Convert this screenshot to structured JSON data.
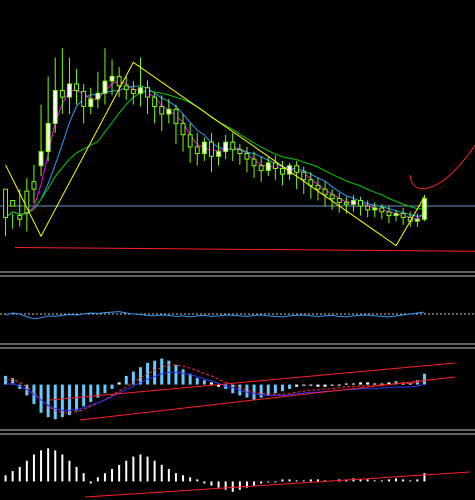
{
  "colors": {
    "background": "#000000",
    "bull_candle": "#7CFC00",
    "bull_body": "#FFFFFF",
    "bear_candle": "#7CFC00",
    "bear_body": "#000000",
    "zigzag": "#FFFF00",
    "ma_fast": "#FF00FF",
    "ma_mid": "#3399FF",
    "ma_slow": "#00CC00",
    "trend_red": "#FF2020",
    "hline": "#6699CC",
    "separator": "#C0C0C0",
    "rsi_line": "#3399FF",
    "rsi_level": "#C0C0C0",
    "hist_pos": "#66CCFF",
    "hist_neg": "#66CCFF",
    "hist_white": "#FFFFFF",
    "signal_red": "#FF3030",
    "signal_blue": "#3333FF"
  },
  "chart_data": [
    {
      "type": "candlestick",
      "panel": "price",
      "title": "",
      "candles": [
        [
          70,
          40,
          20,
          60
        ],
        [
          58,
          52,
          28,
          44
        ],
        [
          42,
          38,
          30,
          70
        ],
        [
          68,
          45,
          25,
          82
        ],
        [
          78,
          70,
          55,
          96
        ],
        [
          95,
          110,
          84,
          160
        ],
        [
          110,
          140,
          100,
          190
        ],
        [
          140,
          175,
          130,
          210
        ],
        [
          175,
          168,
          150,
          220
        ],
        [
          168,
          182,
          150,
          210
        ],
        [
          182,
          175,
          160,
          198
        ],
        [
          174,
          158,
          140,
          182
        ],
        [
          158,
          166,
          150,
          178
        ],
        [
          166,
          172,
          156,
          195
        ],
        [
          172,
          185,
          160,
          220
        ],
        [
          185,
          190,
          170,
          208
        ],
        [
          190,
          180,
          168,
          200
        ],
        [
          180,
          176,
          165,
          190
        ],
        [
          176,
          172,
          160,
          185
        ],
        [
          172,
          178,
          158,
          210
        ],
        [
          178,
          168,
          150,
          186
        ],
        [
          168,
          158,
          140,
          172
        ],
        [
          158,
          150,
          132,
          170
        ],
        [
          150,
          155,
          140,
          166
        ],
        [
          155,
          140,
          118,
          160
        ],
        [
          140,
          128,
          110,
          150
        ],
        [
          128,
          115,
          98,
          140
        ],
        [
          115,
          108,
          95,
          130
        ],
        [
          108,
          120,
          100,
          125
        ],
        [
          120,
          105,
          88,
          130
        ],
        [
          105,
          110,
          95,
          120
        ],
        [
          110,
          120,
          102,
          128
        ],
        [
          120,
          112,
          100,
          130
        ],
        [
          112,
          108,
          96,
          118
        ],
        [
          108,
          102,
          88,
          115
        ],
        [
          102,
          95,
          82,
          110
        ],
        [
          95,
          90,
          78,
          105
        ],
        [
          90,
          98,
          84,
          104
        ],
        [
          98,
          92,
          80,
          106
        ],
        [
          92,
          86,
          74,
          100
        ],
        [
          86,
          95,
          80,
          98
        ],
        [
          95,
          88,
          70,
          100
        ],
        [
          88,
          80,
          65,
          94
        ],
        [
          80,
          74,
          60,
          88
        ],
        [
          74,
          70,
          58,
          82
        ],
        [
          70,
          64,
          52,
          78
        ],
        [
          64,
          60,
          48,
          70
        ],
        [
          60,
          56,
          45,
          66
        ],
        [
          56,
          54,
          44,
          62
        ],
        [
          54,
          58,
          46,
          64
        ],
        [
          58,
          52,
          42,
          62
        ],
        [
          52,
          48,
          40,
          58
        ],
        [
          48,
          50,
          40,
          56
        ],
        [
          50,
          46,
          38,
          54
        ],
        [
          46,
          42,
          34,
          52
        ],
        [
          42,
          44,
          36,
          48
        ],
        [
          44,
          40,
          32,
          50
        ],
        [
          40,
          36,
          30,
          46
        ],
        [
          36,
          38,
          30,
          44
        ],
        [
          38,
          60,
          36,
          64
        ]
      ],
      "ylim": [
        0,
        250
      ]
    },
    {
      "type": "line",
      "panel": "oscillator",
      "title": "",
      "values": [
        48,
        52,
        50,
        44,
        40,
        42,
        46,
        45,
        47,
        49,
        48,
        50,
        52,
        51,
        53,
        54,
        55,
        52,
        50,
        49,
        47,
        46,
        48,
        47,
        45,
        46,
        44,
        46,
        47,
        45,
        46,
        48,
        47,
        46,
        45,
        47,
        48,
        46,
        45,
        44,
        46,
        47,
        48,
        46,
        45,
        46,
        47,
        45,
        44,
        46,
        47,
        48,
        46,
        45,
        44,
        46,
        48,
        50,
        52,
        54
      ],
      "level": 50,
      "ylim": [
        0,
        100
      ]
    },
    {
      "type": "bar",
      "panel": "macd",
      "title": "",
      "values": [
        8,
        6,
        -4,
        -10,
        -18,
        -26,
        -30,
        -32,
        -30,
        -28,
        -24,
        -20,
        -16,
        -12,
        -8,
        -4,
        2,
        8,
        12,
        16,
        20,
        22,
        24,
        22,
        18,
        14,
        10,
        6,
        4,
        2,
        -2,
        -4,
        -8,
        -10,
        -12,
        -14,
        -12,
        -10,
        -8,
        -6,
        -4,
        -2,
        -1,
        -1,
        -2,
        -2,
        -1,
        -1,
        1,
        1,
        2,
        2,
        1,
        1,
        2,
        3,
        2,
        1,
        4,
        10
      ],
      "signal": [
        4,
        5,
        2,
        -2,
        -8,
        -14,
        -20,
        -24,
        -26,
        -26,
        -25,
        -23,
        -20,
        -17,
        -14,
        -10,
        -6,
        -2,
        2,
        6,
        10,
        13,
        16,
        18,
        18,
        17,
        15,
        13,
        10,
        8,
        5,
        2,
        0,
        -3,
        -5,
        -7,
        -8,
        -9,
        -9,
        -9,
        -8,
        -7,
        -6,
        -5,
        -5,
        -4,
        -4,
        -3,
        -2,
        -2,
        -1,
        -1,
        -1,
        0,
        0,
        1,
        1,
        1,
        2,
        4
      ],
      "ylim": [
        -40,
        30
      ]
    },
    {
      "type": "bar",
      "panel": "histogram",
      "title": "",
      "values": [
        6,
        10,
        14,
        20,
        26,
        30,
        32,
        30,
        26,
        20,
        14,
        8,
        -2,
        4,
        8,
        12,
        16,
        20,
        24,
        26,
        24,
        20,
        16,
        12,
        8,
        6,
        4,
        2,
        -2,
        -4,
        -6,
        -8,
        -10,
        -8,
        -6,
        -4,
        -2,
        -1,
        -1,
        2,
        2,
        1,
        1,
        2,
        2,
        1,
        1,
        2,
        2,
        3,
        2,
        2,
        1,
        1,
        2,
        3,
        2,
        1,
        2,
        8
      ],
      "ylim": [
        -15,
        40
      ]
    }
  ]
}
